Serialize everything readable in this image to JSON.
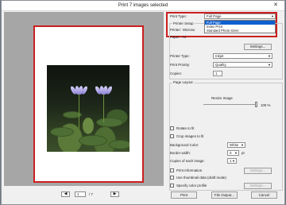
{
  "window": {
    "title": "Print  7 images selected",
    "close_label": "✕"
  },
  "navigation": {
    "prev_label": "◀",
    "page_value": "1",
    "page_total": "/ 7",
    "next_label": "▶"
  },
  "print_type": {
    "label": "Print Type:",
    "selected": "Full Page",
    "options": [
      "Full Page",
      "Index Print",
      "Standard Photo Sizes"
    ],
    "highlight_color": "#cc1f1f"
  },
  "printer_setup": {
    "section_label": "Printer Setup",
    "printer_label": "Printer:",
    "printer_value": "Microso",
    "paper_label": "Paper:",
    "paper_value": "A4",
    "settings_button": "Settings...",
    "printer_type_label": "Printer Type:",
    "printer_type_value": "Inkjet",
    "print_priority_label": "Print Priority:",
    "print_priority_value": "Quality",
    "copies_label": "Copies:",
    "copies_value": "1"
  },
  "page_layout": {
    "section_label": "Page Layout",
    "resize_label": "Resize Image",
    "resize_value": "100 %",
    "resize_fraction": 1.0,
    "rotate_label": "Rotate to fit",
    "crop_label": "Crop images to fit",
    "background_label": "Background Color:",
    "background_value": "White",
    "border_label": "Border width:",
    "border_value": "0",
    "border_unit": "pt",
    "copies_each_label": "Copies of each image:",
    "copies_each_value": "1",
    "print_info_label": "Print Information",
    "print_info_settings": "Settings...",
    "thumbnail_label": "Use thumbnail data (draft mode)",
    "color_profile_label": "Specify color profile",
    "color_profile_settings": "Settings..."
  },
  "footer": {
    "print_button": "Print",
    "file_output_button": "File Output...",
    "cancel_button": "Cancel"
  },
  "colors": {
    "accent_red": "#cc1f1f",
    "selection_blue": "#0f5fcf"
  }
}
